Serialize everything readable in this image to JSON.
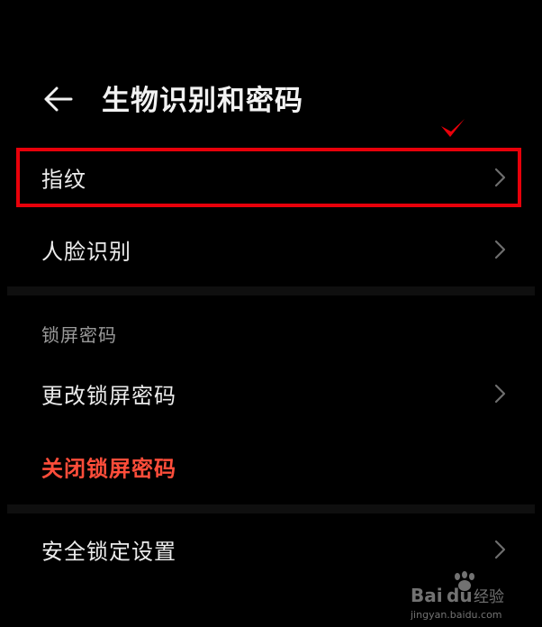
{
  "header": {
    "back_icon": "arrow-left-icon",
    "title": "生物识别和密码"
  },
  "biometrics": {
    "items": [
      {
        "label": "指纹",
        "icon": "chevron-right-icon",
        "highlighted": true
      },
      {
        "label": "人脸识别",
        "icon": "chevron-right-icon"
      }
    ]
  },
  "lock_password_section": {
    "title": "锁屏密码",
    "items": [
      {
        "label": "更改锁屏密码",
        "icon": "chevron-right-icon"
      },
      {
        "label": "关闭锁屏密码"
      }
    ]
  },
  "security_section": {
    "items": [
      {
        "label": "安全锁定设置",
        "icon": "chevron-right-icon"
      }
    ]
  },
  "colors": {
    "background": "#000000",
    "text": "#ececec",
    "danger": "#ff4d3a",
    "annotation": "#e8000a",
    "section_label": "#9a9a9a"
  }
}
